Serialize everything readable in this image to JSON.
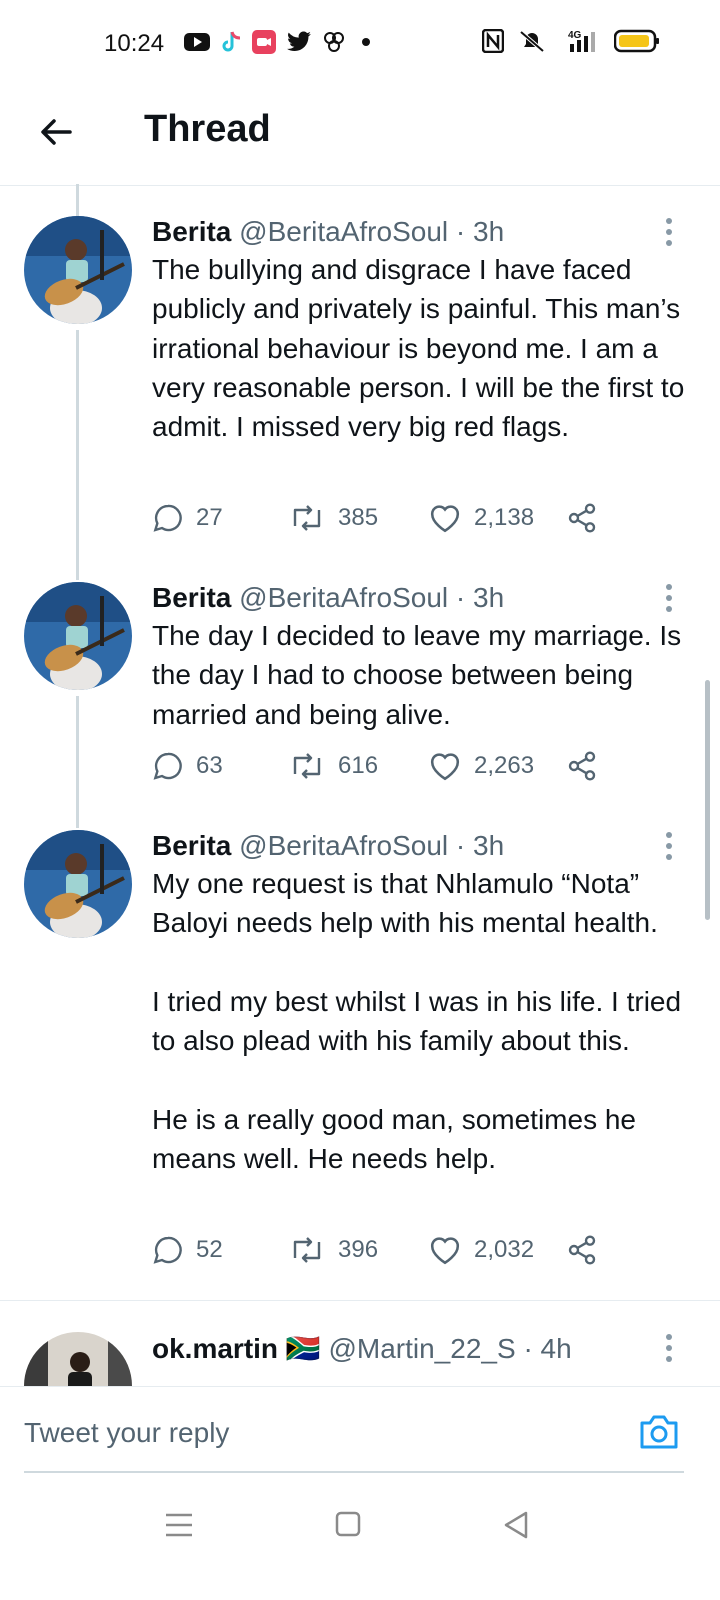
{
  "status_bar": {
    "time": "10:24",
    "network": "4G"
  },
  "header": {
    "title": "Thread"
  },
  "tweets": [
    {
      "name": "Berita",
      "handle": "@BeritaAfroSoul",
      "time": "· 3h",
      "text": "The bullying and disgrace I have faced publicly and privately is painful. This man’s irrational behaviour is beyond me. I am a very reasonable person. I will be the first to admit. I missed very big red flags.",
      "replies": "27",
      "retweets": "385",
      "likes": "2,138"
    },
    {
      "name": "Berita",
      "handle": "@BeritaAfroSoul",
      "time": "· 3h",
      "text": "The day I decided to leave my marriage. Is the day I had to choose between being married and being alive.",
      "replies": "63",
      "retweets": "616",
      "likes": "2,263"
    },
    {
      "name": "Berita",
      "handle": "@BeritaAfroSoul",
      "time": "· 3h",
      "text": "My one request is that Nhlamulo “Nota” Baloyi needs help with his mental health.\n\nI tried my best whilst I was in his life. I tried to also plead with his family about this.\n\nHe is a really good man, sometimes he means well. He needs help.",
      "replies": "52",
      "retweets": "396",
      "likes": "2,032"
    }
  ],
  "next_tweet": {
    "name": "ok.martin",
    "flag": "🇿🇦",
    "handle": "@Martin_22_S",
    "time": "· 4h"
  },
  "reply_bar": {
    "placeholder": "Tweet your reply"
  },
  "colors": {
    "accent": "#1d9bf0",
    "muted": "#536471",
    "divider": "#e6ecf0",
    "thread_line": "#cfd9de"
  },
  "icons": [
    "back-arrow-icon",
    "more-icon",
    "reply-icon",
    "retweet-icon",
    "like-icon",
    "share-icon",
    "camera-icon",
    "menu-icon",
    "home-icon",
    "back-icon"
  ]
}
